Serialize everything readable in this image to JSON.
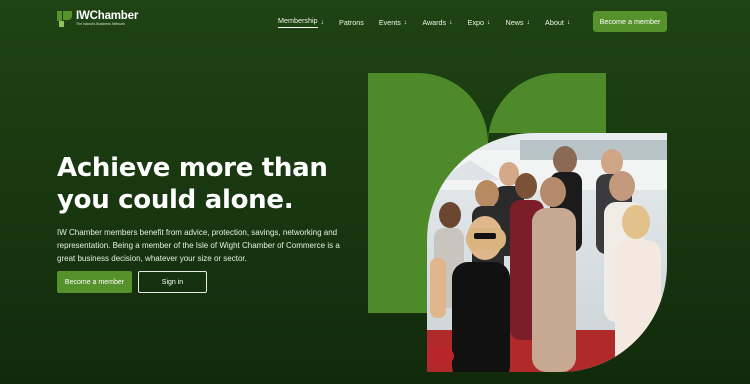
{
  "brand": {
    "name": "IWChamber",
    "tagline": "The Island's Business Network",
    "color": "#56922c"
  },
  "nav": {
    "items": [
      {
        "label": "Membership",
        "dropdown": true,
        "active": true
      },
      {
        "label": "Patrons",
        "dropdown": false
      },
      {
        "label": "Events",
        "dropdown": true
      },
      {
        "label": "Awards",
        "dropdown": true
      },
      {
        "label": "Expo",
        "dropdown": true
      },
      {
        "label": "News",
        "dropdown": true
      },
      {
        "label": "About",
        "dropdown": true
      }
    ],
    "arrow": "↓",
    "cta": "Become a member"
  },
  "hero": {
    "title_line1": "Achieve more than",
    "title_line2": "you could alone.",
    "text": "IW Chamber members benefit from advice, protection, savings, networking and representation. Being a member of the Isle of Wight Chamber of Commerce is a great business decision, whatever your size or sector.",
    "primary_button": "Become a member",
    "secondary_button": "Sign in"
  },
  "colors": {
    "background_top": "#1f4313",
    "background_bottom": "#112a0b",
    "accent": "#56922c",
    "shape": "#4e8a2a"
  },
  "icons": {
    "logo": "chamber-logo-icon",
    "dropdown": "arrow-down-icon"
  }
}
